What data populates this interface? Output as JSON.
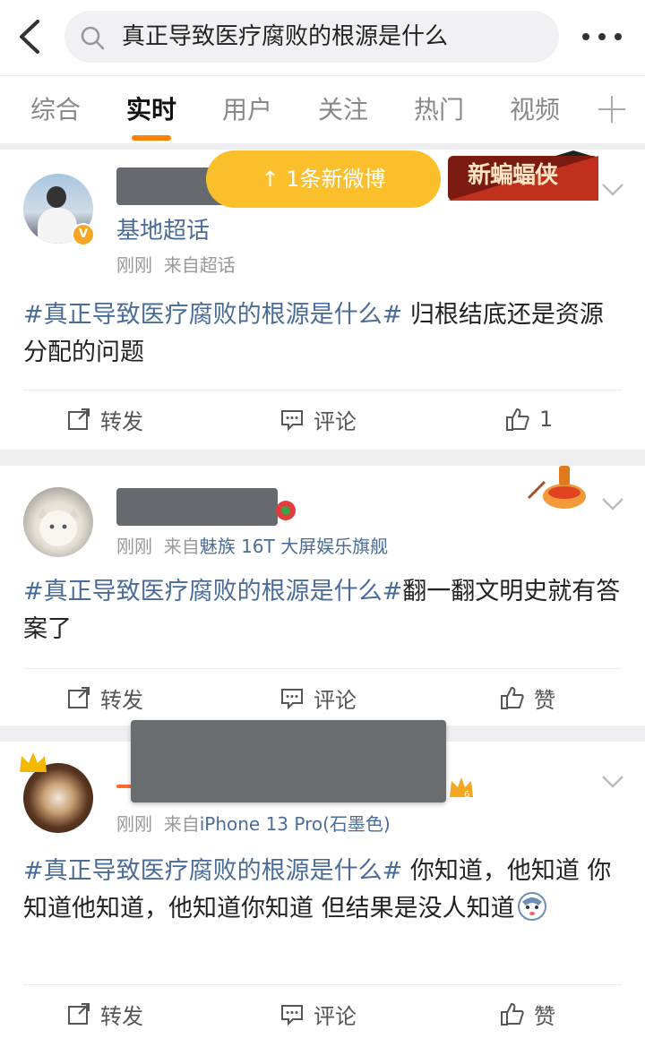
{
  "search": {
    "query": "真正导致医疗腐败的根源是什么"
  },
  "tabs": [
    {
      "label": "综合"
    },
    {
      "label": "实时"
    },
    {
      "label": "用户"
    },
    {
      "label": "关注"
    },
    {
      "label": "热门"
    },
    {
      "label": "视频"
    }
  ],
  "overlay": {
    "new_posts_label": "↑ 1条新微博",
    "promo_label": "新蝙蝠侠"
  },
  "posts": [
    {
      "user_name": "基地超话",
      "time": "刚刚",
      "source_prefix": "来自",
      "source": "超话",
      "topic": "#真正导致医疗腐败的根源是什么#",
      "text": " 归根结底还是资源分配的问题",
      "actions": {
        "repost": "转发",
        "comment": "评论",
        "like": "1"
      }
    },
    {
      "time": "刚刚",
      "source_prefix": "来自",
      "source": "魅族 16T 大屏娱乐旗舰",
      "topic": "#真正导致医疗腐败的根源是什么#",
      "text": "翻一翻文明史就有答案了",
      "actions": {
        "repost": "转发",
        "comment": "评论",
        "like": "赞"
      }
    },
    {
      "time": "刚刚",
      "source_prefix": "来自",
      "source": "iPhone 13 Pro(石墨色)",
      "topic": "#真正导致医疗腐败的根源是什么#",
      "text": " 你知道，他知道 你知道他知道，他知道你知道 但结果是没人知道",
      "actions": {
        "repost": "转发",
        "comment": "评论",
        "like": "赞"
      }
    }
  ],
  "colors": {
    "accent": "#ff8200",
    "link": "#4a6c99",
    "pill": "#fbbf2c"
  }
}
